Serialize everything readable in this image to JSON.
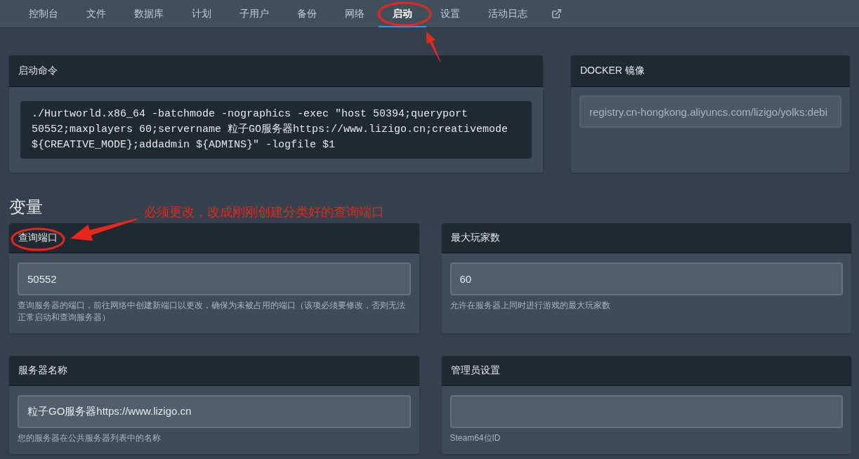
{
  "nav": {
    "items": [
      {
        "label": "控制台",
        "selected": false
      },
      {
        "label": "文件",
        "selected": false
      },
      {
        "label": "数据库",
        "selected": false
      },
      {
        "label": "计划",
        "selected": false
      },
      {
        "label": "子用户",
        "selected": false
      },
      {
        "label": "备份",
        "selected": false
      },
      {
        "label": "网络",
        "selected": false
      },
      {
        "label": "启动",
        "selected": true
      },
      {
        "label": "设置",
        "selected": false
      },
      {
        "label": "活动日志",
        "selected": false
      }
    ]
  },
  "startup": {
    "title": "启动命令",
    "command_lines": [
      "./Hurtworld.x86_64 -batchmode -nographics -exec \"host 50394;queryport",
      "50552;maxplayers 60;servername 粒子GO服务器https://www.lizigo.cn;creativemode",
      "${CREATIVE_MODE};addadmin ${ADMINS}\" -logfile $1"
    ]
  },
  "docker": {
    "title": "DOCKER 镜像",
    "value": "registry.cn-hongkong.aliyuncs.com/lizigo/yolks:debi"
  },
  "variables_heading": "变量",
  "variables": [
    {
      "title": "查询端口",
      "value": "50552",
      "description": "查询服务器的端口，前往网络中创建新端口以更改，确保为未被占用的端口（该项必须要修改，否则无法正常启动和查询服务器）"
    },
    {
      "title": "最大玩家数",
      "value": "60",
      "description": "允许在服务器上同时进行游戏的最大玩家数"
    },
    {
      "title": "服务器名称",
      "value": "粒子GO服务器https://www.lizigo.cn",
      "description": "您的服务器在公共服务器列表中的名称"
    },
    {
      "title": "管理员设置",
      "description": "Steam64位ID"
    }
  ],
  "annotation": {
    "note": "必须更改，改成刚刚创建分类好的查询端口"
  }
}
